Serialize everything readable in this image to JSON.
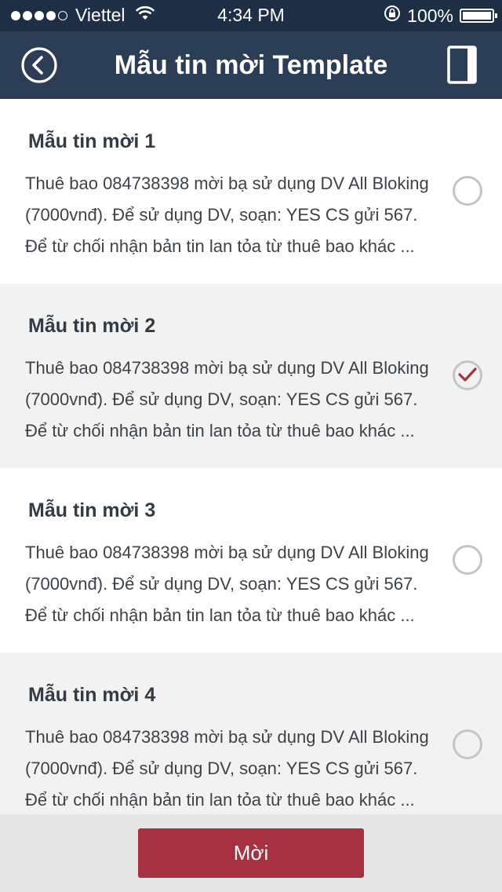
{
  "status_bar": {
    "carrier": "Viettel",
    "time": "4:34 PM",
    "battery": "100%"
  },
  "header": {
    "title": "Mẫu tin mời Template",
    "back_icon": "back-circle-icon",
    "right_icon": "book-icon"
  },
  "templates": [
    {
      "title": "Mẫu tin mời 1",
      "line1": "Thuê bao 084738398 mời bạ sử dụng DV All Bloking",
      "line2": "(7000vnđ). Để sử dụng DV, soạn: YES CS gửi 567.",
      "line3": "Để từ chối nhận bản tin lan tỏa từ thuê bao khác ...",
      "selected": false
    },
    {
      "title": "Mẫu tin mời 2",
      "line1": "Thuê bao 084738398 mời bạ sử dụng DV All Bloking",
      "line2": "(7000vnđ). Để sử dụng DV, soạn: YES CS gửi 567.",
      "line3": "Để từ chối nhận bản tin lan tỏa từ thuê bao khác ...",
      "selected": true
    },
    {
      "title": "Mẫu tin mời 3",
      "line1": "Thuê bao 084738398 mời bạ sử dụng DV All Bloking",
      "line2": "(7000vnđ). Để sử dụng DV, soạn: YES CS gửi 567.",
      "line3": "Để từ chối nhận bản tin lan tỏa từ thuê bao khác ...",
      "selected": false
    },
    {
      "title": "Mẫu tin mời 4",
      "line1": "Thuê bao 084738398 mời bạ sử dụng DV All Bloking",
      "line2": "(7000vnđ). Để sử dụng DV, soạn: YES CS gửi 567.",
      "line3": "Để từ chối nhận bản tin lan tỏa từ thuê bao khác ...",
      "selected": false
    }
  ],
  "footer": {
    "invite_label": "Mời"
  },
  "colors": {
    "status_bar_bg": "#1d2e45",
    "header_bg": "#2c3e56",
    "alt_row_bg": "#f2f2f2",
    "accent": "#a73141",
    "footer_bg": "#e6e6e6"
  }
}
